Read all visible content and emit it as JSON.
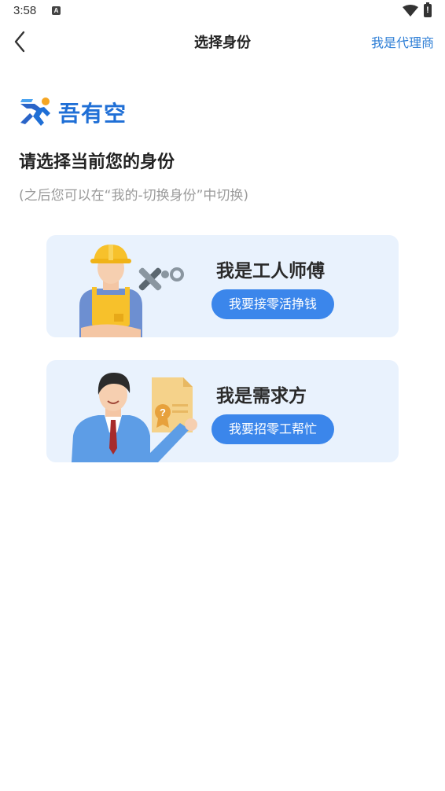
{
  "status_bar": {
    "time": "3:58",
    "notification_glyph": "A"
  },
  "nav": {
    "title": "选择身份",
    "right_link": "我是代理商"
  },
  "brand": {
    "name": "吾有空"
  },
  "heading": "请选择当前您的身份",
  "subheading": "(之后您可以在“我的-切换身份”中切换)",
  "cards": [
    {
      "title": "我是工人师傅",
      "button": "我要接零活挣钱"
    },
    {
      "title": "我是需求方",
      "button": "我要招零工帮忙"
    }
  ],
  "colors": {
    "accent": "#3b86eb",
    "link": "#2f7fd6",
    "card_bg": "#e9f2fd",
    "brand": "#1f6fd6"
  }
}
